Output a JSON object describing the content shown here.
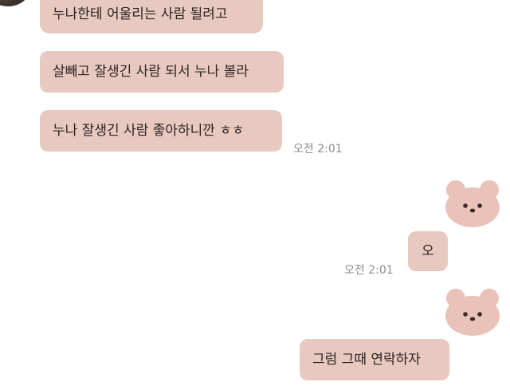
{
  "messages": [
    {
      "text": "누나한테 어울리는 사람 될려고"
    },
    {
      "text": "살빼고 잘생긴 사람 되서 누나 볼라"
    },
    {
      "text": "누나 잘생긴 사람 좋아하니깐 ㅎㅎ"
    },
    {
      "text": "오"
    },
    {
      "text": "그럼 그때 연락하자"
    }
  ],
  "timestamps": [
    "오전 2:01",
    "오전 2:01"
  ],
  "colors": {
    "bubble": "#e8c9c0",
    "background": "#ffffff",
    "timestamp": "#8e8e8e",
    "bear": "#e9c3b9"
  },
  "icons": [
    "avatar",
    "bear-sticker-icon",
    "bear-sticker-icon"
  ]
}
